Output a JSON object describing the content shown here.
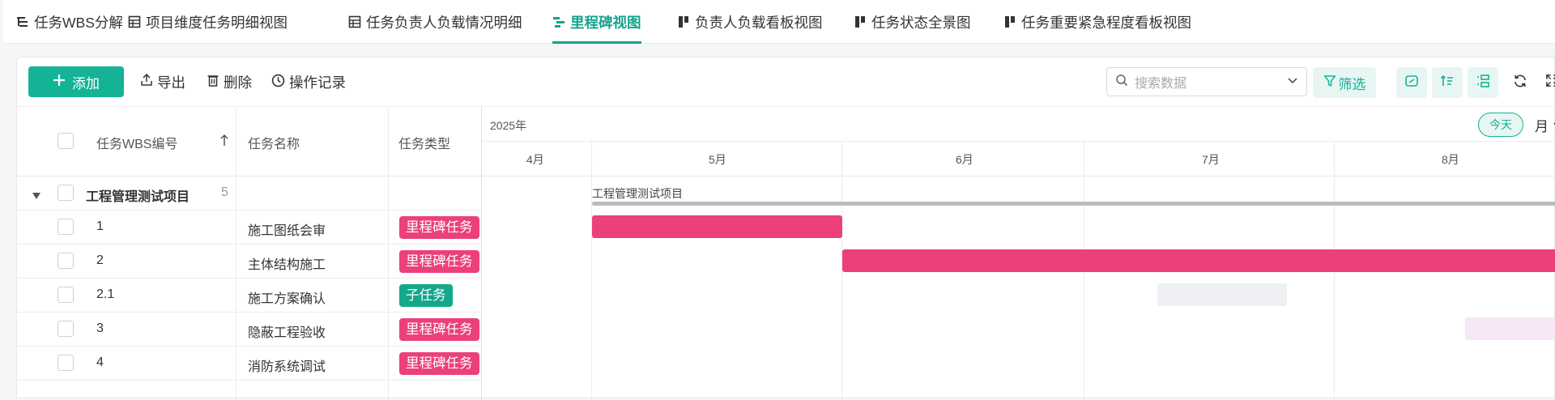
{
  "tabs": [
    {
      "label": "任务WBS分解",
      "icon": "wbs-icon",
      "active": false
    },
    {
      "label": "项目维度任务明细视图",
      "icon": "table-icon",
      "active": false
    },
    {
      "label": "任务负责人负载情况明细",
      "icon": "table-icon",
      "active": false
    },
    {
      "label": "里程碑视图",
      "icon": "gantt-icon",
      "active": true
    },
    {
      "label": "负责人负载看板视图",
      "icon": "kanban-icon",
      "active": false
    },
    {
      "label": "任务状态全景图",
      "icon": "kanban-icon",
      "active": false
    },
    {
      "label": "任务重要紧急程度看板视图",
      "icon": "kanban-icon",
      "active": false
    }
  ],
  "toolbar": {
    "add_label": "添加",
    "export_label": "导出",
    "delete_label": "删除",
    "history_label": "操作记录",
    "search_placeholder": "搜索数据",
    "filter_label": "筛选"
  },
  "table": {
    "headers": {
      "wbs": "任务WBS编号",
      "name": "任务名称",
      "type": "任务类型"
    },
    "group": {
      "label": "工程管理测试项目",
      "count": "5"
    },
    "rows": [
      {
        "wbs": "1",
        "name": "施工图纸会审",
        "type": "里程碑任务",
        "type_kind": "milestone"
      },
      {
        "wbs": "2",
        "name": "主体结构施工",
        "type": "里程碑任务",
        "type_kind": "milestone"
      },
      {
        "wbs": "2.1",
        "name": "施工方案确认",
        "type": "子任务",
        "type_kind": "subtask"
      },
      {
        "wbs": "3",
        "name": "隐蔽工程验收",
        "type": "里程碑任务",
        "type_kind": "milestone"
      },
      {
        "wbs": "4",
        "name": "消防系统调试",
        "type": "里程碑任务",
        "type_kind": "milestone"
      }
    ]
  },
  "gantt": {
    "year": "2025年",
    "months": [
      "4月",
      "5月",
      "6月",
      "7月",
      "8月"
    ],
    "today_label": "今天",
    "scale_label": "月",
    "group_bar_label": "工程管理测试项目"
  },
  "colors": {
    "accent": "#14b396",
    "milestone": "#ec407a",
    "subtask": "#14a88a",
    "group_bar": "#b9bdc3",
    "faint_gray": "#eef0f3",
    "faint_pink": "#f6e6f6"
  }
}
